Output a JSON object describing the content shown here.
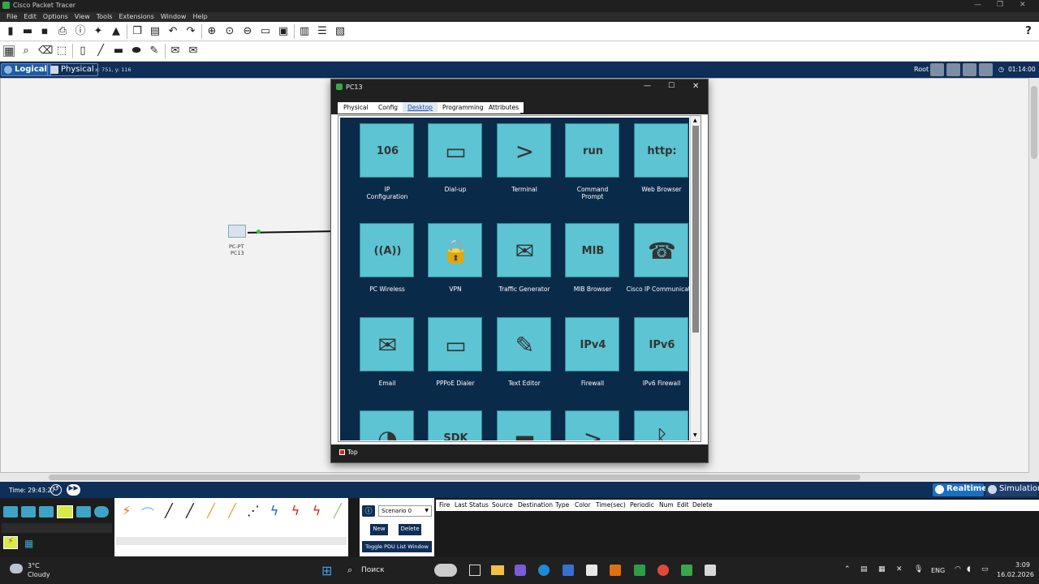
{
  "window": {
    "title": "Cisco Packet Tracer",
    "help": "?"
  },
  "menu": [
    "File",
    "Edit",
    "Options",
    "View",
    "Tools",
    "Extensions",
    "Window",
    "Help"
  ],
  "modes": {
    "logical": "Logical",
    "physical": "Physical",
    "coords": "x: 751, y: 116",
    "root": "Root",
    "clock": "01:14:00"
  },
  "device": {
    "type": "PC-PT",
    "name": "PC13"
  },
  "dialog": {
    "title": "PC13",
    "tabs": [
      "Physical",
      "Config",
      "Desktop",
      "Programming",
      "Attributes"
    ],
    "selected_tab": "Desktop",
    "apps": [
      {
        "label": "IP\nConfiguration",
        "icon": "ip-config-icon",
        "glyph": "106"
      },
      {
        "label": "Dial-up",
        "icon": "modem-icon",
        "glyph": "▭"
      },
      {
        "label": "Terminal",
        "icon": "terminal-icon",
        "glyph": ">"
      },
      {
        "label": "Command\nPrompt",
        "icon": "command-prompt-icon",
        "glyph": "run"
      },
      {
        "label": "Web Browser",
        "icon": "web-browser-icon",
        "glyph": "http:"
      },
      {
        "label": "PC Wireless",
        "icon": "wireless-antenna-icon",
        "glyph": "((A))"
      },
      {
        "label": "VPN",
        "icon": "vpn-lock-icon",
        "glyph": "🔒"
      },
      {
        "label": "Traffic Generator",
        "icon": "traffic-generator-icon",
        "glyph": "✉"
      },
      {
        "label": "MIB Browser",
        "icon": "mib-browser-icon",
        "glyph": "MIB"
      },
      {
        "label": "Cisco IP Communicator",
        "icon": "ip-communicator-icon",
        "glyph": "☎"
      },
      {
        "label": "Email",
        "icon": "email-icon",
        "glyph": "✉"
      },
      {
        "label": "PPPoE Dialer",
        "icon": "pppoe-dialer-icon",
        "glyph": "▭"
      },
      {
        "label": "Text Editor",
        "icon": "text-editor-icon",
        "glyph": "✎"
      },
      {
        "label": "Firewall",
        "icon": "ipv4-firewall-icon",
        "glyph": "IPv4"
      },
      {
        "label": "IPv6 Firewall",
        "icon": "ipv6-firewall-icon",
        "glyph": "IPv6"
      },
      {
        "label": "",
        "icon": "pie-chart-icon",
        "glyph": "◔"
      },
      {
        "label": "",
        "icon": "sdk-box-icon",
        "glyph": "SDK"
      },
      {
        "label": "",
        "icon": "folder-icon",
        "glyph": "▬"
      },
      {
        "label": "",
        "icon": "terminal-lock-icon",
        "glyph": ">"
      },
      {
        "label": "",
        "icon": "bluetooth-icon",
        "glyph": "ᛒ"
      }
    ],
    "footer": "Top"
  },
  "timebar": {
    "time": "Time: 29:43:27",
    "realtime": "Realtime",
    "simulation": "Simulation"
  },
  "scenario": {
    "name": "Scenario 0",
    "new": "New",
    "delete": "Delete",
    "toggle": "Toggle PDU List Window"
  },
  "pdu_columns": [
    "Fire",
    "Last Status",
    "Source",
    "Destination",
    "Type",
    "Color",
    "Time(sec)",
    "Periodic",
    "Num",
    "Edit",
    "Delete"
  ],
  "taskbar": {
    "temp": "3°C",
    "weather": "Cloudy",
    "search": "Поиск",
    "lang": "ENG",
    "time": "3:09",
    "date": "16.02.2026"
  },
  "colors": {
    "accent": "#0f2e58",
    "tile": "#5cc4d2",
    "apps_bg": "#0a2a4a"
  }
}
